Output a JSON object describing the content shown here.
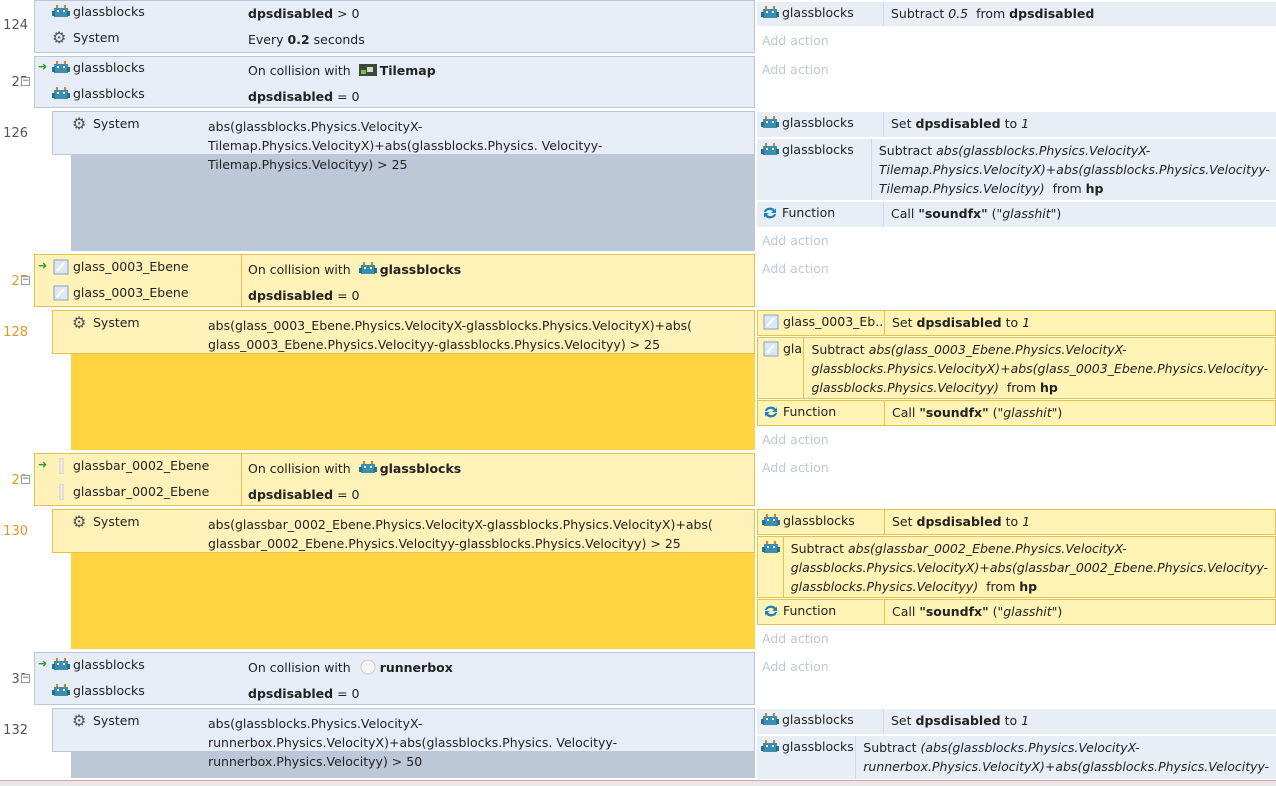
{
  "add_action_label": "Add action",
  "words": {
    "on_collision_with": "On collision with",
    "every": "Every",
    "seconds": "seconds",
    "subtract": "Subtract",
    "from": "from",
    "set": "Set",
    "to": "to",
    "call": "Call"
  },
  "objects": {
    "glassblocks": "glassblocks",
    "system": "System",
    "tilemap": "Tilemap",
    "glass_0003": "glass_0003_Ebene",
    "glass_0003_short": "glass_0003_Eb...",
    "glassbar": "glassbar_0002_Ebene",
    "runnerbox": "runnerbox",
    "function": "Function"
  },
  "lines": {
    "l124": "124",
    "l125": "25",
    "l126": "126",
    "l127": "27",
    "l128": "128",
    "l129": "29",
    "l130": "130",
    "l131": "31",
    "l132": "132"
  },
  "cond": {
    "dpsdisabled": "dpsdisabled",
    "gt0": "> 0",
    "eq0": "= 0",
    "every_value": "0.2",
    "c126": "abs(glassblocks.Physics.VelocityX-Tilemap.Physics.VelocityX)+abs(glassblocks.Physics. Velocityy-Tilemap.Physics.Velocityy) > 25",
    "c128": "abs(glass_0003_Ebene.Physics.VelocityX-glassblocks.Physics.VelocityX)+abs( glass_0003_Ebene.Physics.Velocityy-glassblocks.Physics.Velocityy) > 25",
    "c130": "abs(glassbar_0002_Ebene.Physics.VelocityX-glassblocks.Physics.VelocityX)+abs( glassbar_0002_Ebene.Physics.Velocityy-glassblocks.Physics.Velocityy) > 25",
    "c132": "abs(glassblocks.Physics.VelocityX-runnerbox.Physics.VelocityX)+abs(glassblocks.Physics. Velocityy-runnerbox.Physics.Velocityy) > 50"
  },
  "act": {
    "sub_value": "0.5",
    "set_value": "1",
    "hp": "hp",
    "soundfx": "\"soundfx\"",
    "glasshit": "\"glasshit\"",
    "e126": "abs(glassblocks.Physics.VelocityX-Tilemap.Physics.VelocityX)+abs(glassblocks.Physics.Velocityy-Tilemap.Physics.Velocityy)",
    "e128": "abs(glass_0003_Ebene.Physics.VelocityX-glassblocks.Physics.VelocityX)+abs(glass_0003_Ebene.Physics.Velocityy-glassblocks.Physics.Velocityy)",
    "e130": "abs(glassbar_0002_Ebene.Physics.VelocityX-glassblocks.Physics.VelocityX)+abs(glassbar_0002_Ebene.Physics.Velocityy-glassblocks.Physics.Velocityy)",
    "e132": "(abs(glassblocks.Physics.VelocityX-runnerbox.Physics.VelocityX)+abs(glassblocks.Physics.Velocityy-"
  },
  "colors": {
    "selected_event": "#ffd440",
    "normal_event": "#bcc8d8"
  }
}
